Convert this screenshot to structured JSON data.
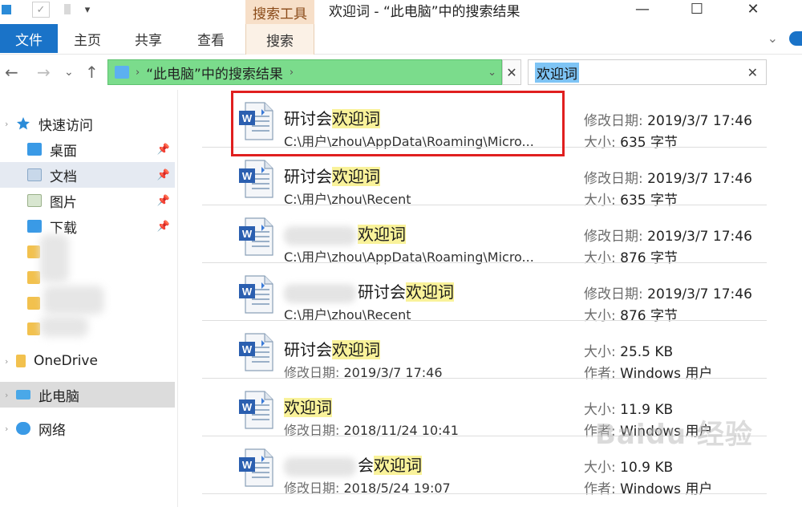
{
  "window": {
    "title": "欢迎词 - “此电脑”中的搜索结果",
    "context_tab": "搜索工具",
    "controls": {
      "minimize": "—",
      "maximize": "☐",
      "close": "✕"
    }
  },
  "quick_access_toolbar": {
    "check": "✓",
    "dropdown": "▾"
  },
  "ribbon": {
    "tabs": [
      "文件",
      "主页",
      "共享",
      "查看",
      "搜索"
    ],
    "collapse": "⌄"
  },
  "nav_buttons": {
    "back": "←",
    "forward": "→",
    "recent": "⌄",
    "up": "↑"
  },
  "address": {
    "chevron": "›",
    "path": "“此电脑”中的搜索结果",
    "chevron_end": "›",
    "dropdown": "⌄",
    "clear": "✕"
  },
  "search": {
    "query": "欢迎词",
    "clear": "✕"
  },
  "nav_pane": {
    "expand": "›",
    "pin": "📌",
    "quick_access": "快速访问",
    "items": [
      {
        "label": "桌面",
        "pinned": true
      },
      {
        "label": "文档",
        "pinned": true,
        "selected": true
      },
      {
        "label": "图片",
        "pinned": true
      },
      {
        "label": "下载",
        "pinned": true
      }
    ],
    "onedrive": "OneDrive",
    "this_pc": "此电脑",
    "network": "网络"
  },
  "results": [
    {
      "prefix": "研讨会",
      "match": "欢迎词",
      "suffix": "",
      "sub_label": "",
      "sub_value": "C:\\用户\\zhou\\AppData\\Roaming\\Micro...",
      "meta1_label": "修改日期:",
      "meta1_value": "2019/3/7 17:46",
      "meta2_label": "大小:",
      "meta2_value": "635 字节",
      "highlighted_box": true
    },
    {
      "prefix": "研讨会",
      "match": "欢迎词",
      "suffix": "",
      "sub_label": "",
      "sub_value": "C:\\用户\\zhou\\Recent",
      "meta1_label": "修改日期:",
      "meta1_value": "2019/3/7 17:46",
      "meta2_label": "大小:",
      "meta2_value": "635 字节"
    },
    {
      "prefix": "",
      "match": "欢迎词",
      "suffix": "",
      "sub_label": "",
      "sub_value": "C:\\用户\\zhou\\AppData\\Roaming\\Micro...",
      "meta1_label": "修改日期:",
      "meta1_value": "2019/3/7 17:46",
      "meta2_label": "大小:",
      "meta2_value": "876 字节",
      "name_blurred": true
    },
    {
      "prefix": "研讨会",
      "match": "欢迎词",
      "suffix": "",
      "sub_label": "",
      "sub_value": "C:\\用户\\zhou\\Recent",
      "meta1_label": "修改日期:",
      "meta1_value": "2019/3/7 17:46",
      "meta2_label": "大小:",
      "meta2_value": "876 字节",
      "name_blurred": true
    },
    {
      "prefix": "研讨会",
      "match": "欢迎词",
      "suffix": "",
      "sub_label": "修改日期:",
      "sub_value": "2019/3/7 17:46",
      "meta1_label": "大小:",
      "meta1_value": "25.5 KB",
      "meta2_label": "作者:",
      "meta2_value": "Windows 用户"
    },
    {
      "prefix": "",
      "match": "欢迎词",
      "suffix": "",
      "sub_label": "修改日期:",
      "sub_value": "2018/11/24 10:41",
      "meta1_label": "大小:",
      "meta1_value": "11.9 KB",
      "meta2_label": "作者:",
      "meta2_value": "Windows 用户"
    },
    {
      "prefix": "会",
      "match": "欢迎词",
      "suffix": "",
      "sub_label": "修改日期:",
      "sub_value": "2018/5/24 19:07",
      "meta1_label": "大小:",
      "meta1_value": "10.9 KB",
      "meta2_label": "作者:",
      "meta2_value": "Windows 用户",
      "name_blurred": true
    }
  ],
  "watermark": "Baidu 经验",
  "colors": {
    "file_tab": "#1a73c8",
    "address_bar": "#7bdc8c",
    "search_highlight": "#7ec4f5",
    "match_highlight": "#f9f29a",
    "red_box": "#e01f1f",
    "context_tab": "#f7dfc8"
  }
}
